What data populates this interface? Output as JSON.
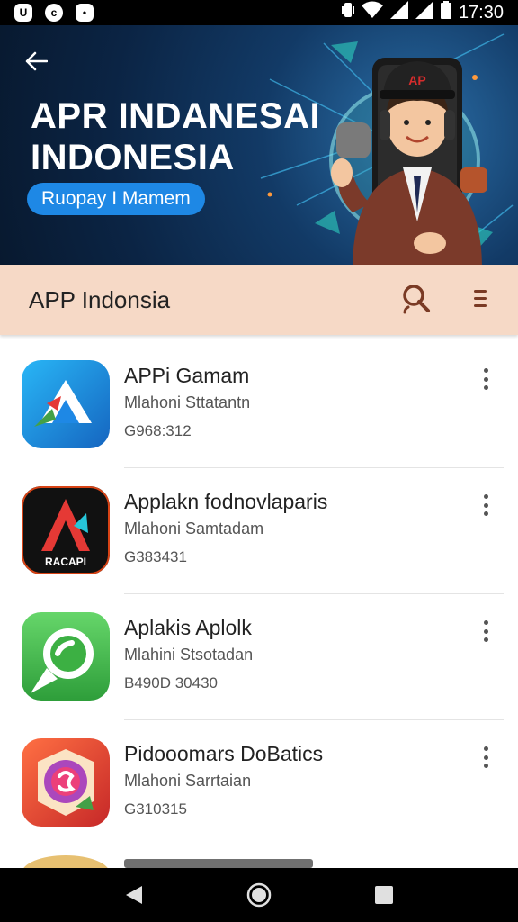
{
  "status_bar": {
    "left_icons": [
      "app-notification-icon",
      "notification-icon",
      "notification-icon"
    ],
    "right_icons": [
      "vibrate-icon",
      "wifi-icon",
      "signal-icon",
      "signal-icon",
      "battery-icon"
    ],
    "time": "17:30"
  },
  "banner": {
    "title_line1": "APR INDANESAI",
    "title_line2": "INDONESIA",
    "pill_label": "Ruopay I Mamem",
    "mascot_cap_text": "AP"
  },
  "app_bar": {
    "title": "APP Indonsia"
  },
  "apps": [
    {
      "name": "APPi Gamam",
      "developer": "Mlahoni Sttatantn",
      "size": "G968:312",
      "icon": "app-icon-blue-triangle"
    },
    {
      "name": "Applakn fodnovlaparis",
      "developer": "Mlahoni Samtadam",
      "size": "G383431",
      "icon": "app-icon-black-a",
      "icon_text": "RACAPI"
    },
    {
      "name": "Aplakis Aplolk",
      "developer": "Mlahini Stsotadan",
      "size": "B490D 30430",
      "icon": "app-icon-green-chat"
    },
    {
      "name": "Pidooomars DoBatics",
      "developer": "Mlahoni Sarrtaian",
      "size": "G310315",
      "icon": "app-icon-red-camera"
    }
  ],
  "nav_bar": {
    "buttons": [
      "back-icon",
      "home-icon",
      "recents-icon"
    ]
  },
  "colors": {
    "banner_bg": "#0b2444",
    "app_bar_bg": "#f6d9c6",
    "pill_bg": "#1e88e5"
  }
}
